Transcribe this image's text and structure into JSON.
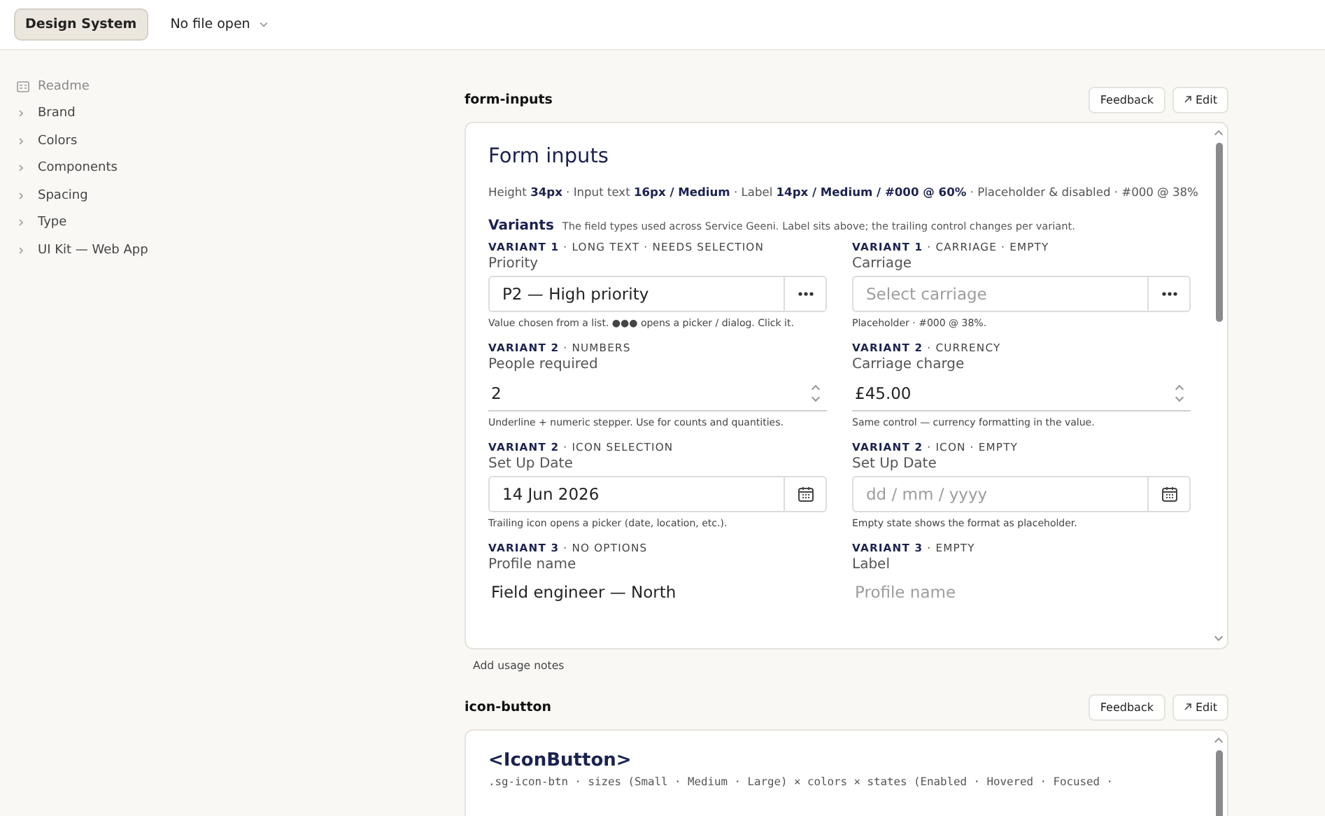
{
  "topbar": {
    "tabs": [
      {
        "label": "Design System",
        "selected": true
      }
    ],
    "file_menu": {
      "label": "No file open"
    }
  },
  "sidebar": {
    "items": [
      {
        "label": "Readme",
        "kind": "doc"
      },
      {
        "label": "Brand",
        "kind": "group",
        "expanded": false
      },
      {
        "label": "Colors",
        "kind": "group",
        "expanded": false
      },
      {
        "label": "Components",
        "kind": "group",
        "expanded": false
      },
      {
        "label": "Spacing",
        "kind": "group",
        "expanded": false
      },
      {
        "label": "Type",
        "kind": "group",
        "expanded": false
      },
      {
        "label": "UI Kit — Web App",
        "kind": "group",
        "expanded": false
      }
    ]
  },
  "sections": [
    {
      "name": "form-inputs",
      "buttons": [
        "Feedback",
        "Edit"
      ],
      "kind": "form",
      "title": "Form inputs",
      "specs": "Height **34px** · Input text **16px / Medium** · Label **14px / Medium / #000 @ 60%** · Placeholder & disabled · #000 @ 38%",
      "variants_heading": "Variants",
      "variants_note": "The field types used across Service Geeni. Label sits above; the trailing control changes per variant.",
      "fields": [
        {
          "tag": "**VARIANT 1** · LONG TEXT · NEEDS SELECTION",
          "label": "Priority",
          "kind": "picker",
          "trailing_icon": {
            "kind": "dots"
          },
          "value": "P2 — High priority",
          "hint": "Value chosen from a list. ●●● opens a picker / dialog. Click it."
        },
        {
          "tag": "**VARIANT 1** · CARRIAGE · EMPTY",
          "label": "Carriage",
          "kind": "picker",
          "trailing_icon": {
            "kind": "dots"
          },
          "placeholder": "Select carriage",
          "hint": "Placeholder · #000 @ 38%."
        },
        {
          "tag": "**VARIANT 2** · NUMBERS",
          "label": "People required",
          "kind": "stepper",
          "value": "2",
          "hint": "Underline + numeric stepper. Use for counts and quantities."
        },
        {
          "tag": "**VARIANT 2** · CURRENCY",
          "label": "Carriage charge",
          "kind": "stepper",
          "value": "£45.00",
          "hint": "Same control — currency formatting in the value."
        },
        {
          "tag": "**VARIANT 2** · ICON SELECTION",
          "label": "Set Up Date",
          "kind": "picker",
          "trailing_icon": {
            "kind": "calendar"
          },
          "value": "14 Jun 2026",
          "hint": "Trailing icon opens a picker (date, location, etc.)."
        },
        {
          "tag": "**VARIANT 2** · ICON · EMPTY",
          "label": "Set Up Date",
          "kind": "picker",
          "trailing_icon": {
            "kind": "calendar"
          },
          "placeholder": "dd / mm / yyyy",
          "hint": "Empty state shows the format as placeholder."
        },
        {
          "tag": "**VARIANT 3** · NO OPTIONS",
          "label": "Profile name",
          "kind": "plain",
          "value": "Field engineer — North"
        },
        {
          "tag": "**VARIANT 3** · EMPTY",
          "label": "Label",
          "kind": "plain",
          "placeholder": "Profile name"
        }
      ],
      "footer_link": "Add usage notes"
    },
    {
      "name": "icon-button",
      "buttons": [
        "Feedback",
        "Edit"
      ],
      "kind": "code",
      "title": "<IconButton>",
      "code_line": ".sg-icon-btn · sizes (Small · Medium · Large) × colors × states (Enabled · Hovered · Focused ·"
    }
  ]
}
